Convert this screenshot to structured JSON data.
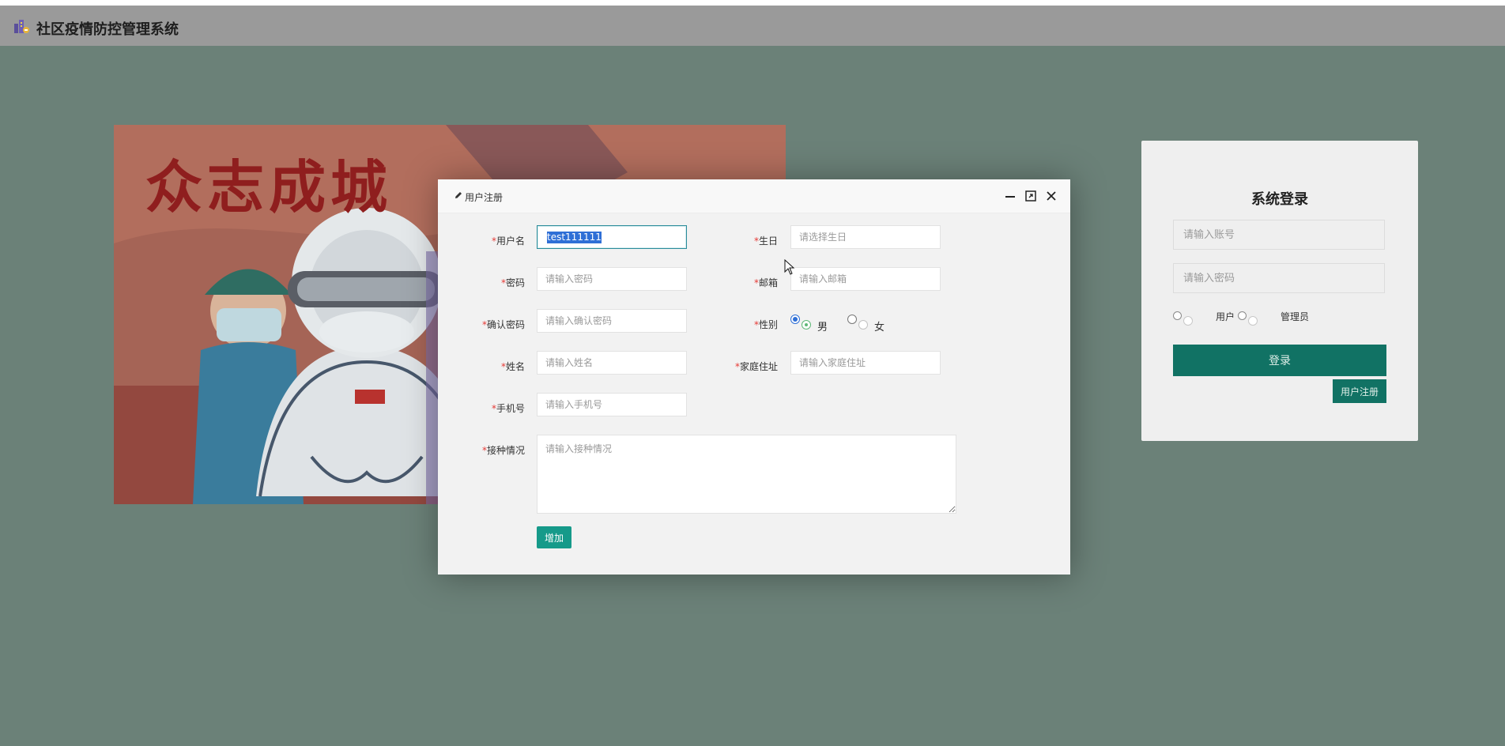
{
  "header": {
    "title": "社区疫情防控管理系统",
    "logo_icon": "community-building-logo-icon"
  },
  "poster": {
    "slogan": "众志成城"
  },
  "login": {
    "title": "系统登录",
    "account_placeholder": "请输入账号",
    "password_placeholder": "请输入密码",
    "role_user": "用户",
    "role_admin": "管理员",
    "login_button": "登录",
    "register_button": "用户注册"
  },
  "dialog": {
    "title": "用户注册",
    "fields": {
      "username": {
        "label": "用户名",
        "value": "test111111"
      },
      "password": {
        "label": "密码",
        "placeholder": "请输入密码"
      },
      "confirm_password": {
        "label": "确认密码",
        "placeholder": "请输入确认密码"
      },
      "name": {
        "label": "姓名",
        "placeholder": "请输入姓名"
      },
      "phone": {
        "label": "手机号",
        "placeholder": "请输入手机号"
      },
      "vaccination": {
        "label": "接种情况",
        "placeholder": "请输入接种情况"
      },
      "birthday": {
        "label": "生日",
        "placeholder": "请选择生日"
      },
      "email": {
        "label": "邮箱",
        "placeholder": "请输入邮箱"
      },
      "gender": {
        "label": "性别",
        "options": [
          "男",
          "女"
        ],
        "selected": "男"
      },
      "address": {
        "label": "家庭住址",
        "placeholder": "请输入家庭住址"
      }
    },
    "required_mark": "*",
    "add_button": "增加"
  },
  "colors": {
    "backdrop": "#6b8178",
    "header": "#9a9a9a",
    "primary": "#117264",
    "add_button": "#169a8a",
    "required": "#e53935"
  }
}
